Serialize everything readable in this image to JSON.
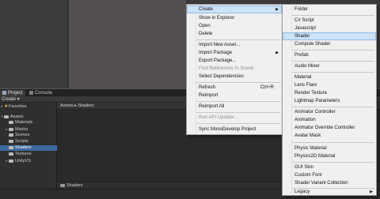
{
  "tabs": {
    "project": "Project",
    "console": "Console"
  },
  "toolbar": {
    "create_label": "Create ▾"
  },
  "tree": {
    "favorites": "Favorites",
    "assets": "Assets",
    "children": [
      "Materials",
      "Meshs",
      "Scenes",
      "Scripts",
      "Shaders",
      "Textures",
      "UnityVS"
    ]
  },
  "content": {
    "breadcrumb": "Assets ▸ Shaders",
    "footer_path": "Shaders"
  },
  "context_menu": {
    "items": [
      "Create",
      "Show in Explorer",
      "Open",
      "Delete",
      "Import New Asset...",
      "Import Package",
      "Export Package...",
      "Find References In Scene",
      "Select Dependencies",
      "Refresh",
      "Reimport",
      "Reimport All",
      "Run API Updater...",
      "Sync MonoDevelop Project"
    ],
    "refresh_shortcut": "Ctrl+R"
  },
  "create_menu": {
    "items": [
      "Folder",
      "C# Script",
      "Javascript",
      "Shader",
      "Compute Shader",
      "Prefab",
      "Audio Mixer",
      "Material",
      "Lens Flare",
      "Render Texture",
      "Lightmap Parameters",
      "Animator Controller",
      "Animation",
      "Animator Override Controller",
      "Avatar Mask",
      "Physic Material",
      "Physics2D Material",
      "GUI Skin",
      "Custom Font",
      "Shader Variant Collection",
      "Legacy"
    ]
  }
}
